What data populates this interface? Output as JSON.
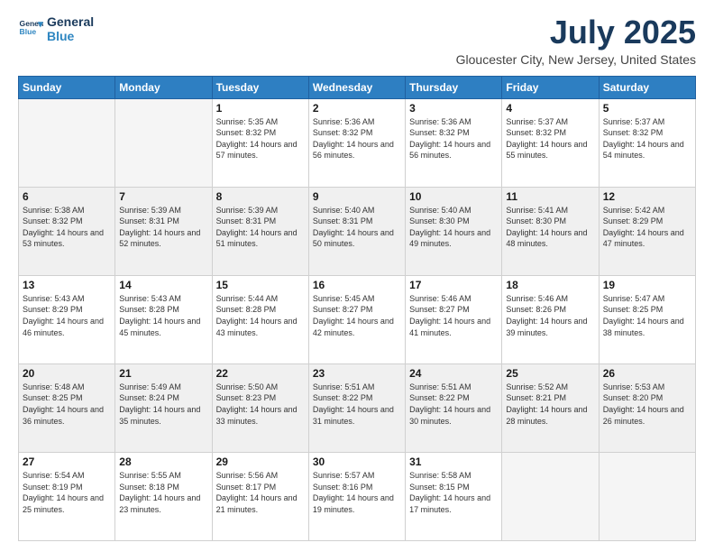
{
  "header": {
    "logo_line1": "General",
    "logo_line2": "Blue",
    "title": "July 2025",
    "subtitle": "Gloucester City, New Jersey, United States"
  },
  "weekdays": [
    "Sunday",
    "Monday",
    "Tuesday",
    "Wednesday",
    "Thursday",
    "Friday",
    "Saturday"
  ],
  "weeks": [
    [
      {
        "day": "",
        "sunrise": "",
        "sunset": "",
        "daylight": "",
        "empty": true
      },
      {
        "day": "",
        "sunrise": "",
        "sunset": "",
        "daylight": "",
        "empty": true
      },
      {
        "day": "1",
        "sunrise": "Sunrise: 5:35 AM",
        "sunset": "Sunset: 8:32 PM",
        "daylight": "Daylight: 14 hours and 57 minutes.",
        "empty": false
      },
      {
        "day": "2",
        "sunrise": "Sunrise: 5:36 AM",
        "sunset": "Sunset: 8:32 PM",
        "daylight": "Daylight: 14 hours and 56 minutes.",
        "empty": false
      },
      {
        "day": "3",
        "sunrise": "Sunrise: 5:36 AM",
        "sunset": "Sunset: 8:32 PM",
        "daylight": "Daylight: 14 hours and 56 minutes.",
        "empty": false
      },
      {
        "day": "4",
        "sunrise": "Sunrise: 5:37 AM",
        "sunset": "Sunset: 8:32 PM",
        "daylight": "Daylight: 14 hours and 55 minutes.",
        "empty": false
      },
      {
        "day": "5",
        "sunrise": "Sunrise: 5:37 AM",
        "sunset": "Sunset: 8:32 PM",
        "daylight": "Daylight: 14 hours and 54 minutes.",
        "empty": false
      }
    ],
    [
      {
        "day": "6",
        "sunrise": "Sunrise: 5:38 AM",
        "sunset": "Sunset: 8:32 PM",
        "daylight": "Daylight: 14 hours and 53 minutes.",
        "empty": false
      },
      {
        "day": "7",
        "sunrise": "Sunrise: 5:39 AM",
        "sunset": "Sunset: 8:31 PM",
        "daylight": "Daylight: 14 hours and 52 minutes.",
        "empty": false
      },
      {
        "day": "8",
        "sunrise": "Sunrise: 5:39 AM",
        "sunset": "Sunset: 8:31 PM",
        "daylight": "Daylight: 14 hours and 51 minutes.",
        "empty": false
      },
      {
        "day": "9",
        "sunrise": "Sunrise: 5:40 AM",
        "sunset": "Sunset: 8:31 PM",
        "daylight": "Daylight: 14 hours and 50 minutes.",
        "empty": false
      },
      {
        "day": "10",
        "sunrise": "Sunrise: 5:40 AM",
        "sunset": "Sunset: 8:30 PM",
        "daylight": "Daylight: 14 hours and 49 minutes.",
        "empty": false
      },
      {
        "day": "11",
        "sunrise": "Sunrise: 5:41 AM",
        "sunset": "Sunset: 8:30 PM",
        "daylight": "Daylight: 14 hours and 48 minutes.",
        "empty": false
      },
      {
        "day": "12",
        "sunrise": "Sunrise: 5:42 AM",
        "sunset": "Sunset: 8:29 PM",
        "daylight": "Daylight: 14 hours and 47 minutes.",
        "empty": false
      }
    ],
    [
      {
        "day": "13",
        "sunrise": "Sunrise: 5:43 AM",
        "sunset": "Sunset: 8:29 PM",
        "daylight": "Daylight: 14 hours and 46 minutes.",
        "empty": false
      },
      {
        "day": "14",
        "sunrise": "Sunrise: 5:43 AM",
        "sunset": "Sunset: 8:28 PM",
        "daylight": "Daylight: 14 hours and 45 minutes.",
        "empty": false
      },
      {
        "day": "15",
        "sunrise": "Sunrise: 5:44 AM",
        "sunset": "Sunset: 8:28 PM",
        "daylight": "Daylight: 14 hours and 43 minutes.",
        "empty": false
      },
      {
        "day": "16",
        "sunrise": "Sunrise: 5:45 AM",
        "sunset": "Sunset: 8:27 PM",
        "daylight": "Daylight: 14 hours and 42 minutes.",
        "empty": false
      },
      {
        "day": "17",
        "sunrise": "Sunrise: 5:46 AM",
        "sunset": "Sunset: 8:27 PM",
        "daylight": "Daylight: 14 hours and 41 minutes.",
        "empty": false
      },
      {
        "day": "18",
        "sunrise": "Sunrise: 5:46 AM",
        "sunset": "Sunset: 8:26 PM",
        "daylight": "Daylight: 14 hours and 39 minutes.",
        "empty": false
      },
      {
        "day": "19",
        "sunrise": "Sunrise: 5:47 AM",
        "sunset": "Sunset: 8:25 PM",
        "daylight": "Daylight: 14 hours and 38 minutes.",
        "empty": false
      }
    ],
    [
      {
        "day": "20",
        "sunrise": "Sunrise: 5:48 AM",
        "sunset": "Sunset: 8:25 PM",
        "daylight": "Daylight: 14 hours and 36 minutes.",
        "empty": false
      },
      {
        "day": "21",
        "sunrise": "Sunrise: 5:49 AM",
        "sunset": "Sunset: 8:24 PM",
        "daylight": "Daylight: 14 hours and 35 minutes.",
        "empty": false
      },
      {
        "day": "22",
        "sunrise": "Sunrise: 5:50 AM",
        "sunset": "Sunset: 8:23 PM",
        "daylight": "Daylight: 14 hours and 33 minutes.",
        "empty": false
      },
      {
        "day": "23",
        "sunrise": "Sunrise: 5:51 AM",
        "sunset": "Sunset: 8:22 PM",
        "daylight": "Daylight: 14 hours and 31 minutes.",
        "empty": false
      },
      {
        "day": "24",
        "sunrise": "Sunrise: 5:51 AM",
        "sunset": "Sunset: 8:22 PM",
        "daylight": "Daylight: 14 hours and 30 minutes.",
        "empty": false
      },
      {
        "day": "25",
        "sunrise": "Sunrise: 5:52 AM",
        "sunset": "Sunset: 8:21 PM",
        "daylight": "Daylight: 14 hours and 28 minutes.",
        "empty": false
      },
      {
        "day": "26",
        "sunrise": "Sunrise: 5:53 AM",
        "sunset": "Sunset: 8:20 PM",
        "daylight": "Daylight: 14 hours and 26 minutes.",
        "empty": false
      }
    ],
    [
      {
        "day": "27",
        "sunrise": "Sunrise: 5:54 AM",
        "sunset": "Sunset: 8:19 PM",
        "daylight": "Daylight: 14 hours and 25 minutes.",
        "empty": false
      },
      {
        "day": "28",
        "sunrise": "Sunrise: 5:55 AM",
        "sunset": "Sunset: 8:18 PM",
        "daylight": "Daylight: 14 hours and 23 minutes.",
        "empty": false
      },
      {
        "day": "29",
        "sunrise": "Sunrise: 5:56 AM",
        "sunset": "Sunset: 8:17 PM",
        "daylight": "Daylight: 14 hours and 21 minutes.",
        "empty": false
      },
      {
        "day": "30",
        "sunrise": "Sunrise: 5:57 AM",
        "sunset": "Sunset: 8:16 PM",
        "daylight": "Daylight: 14 hours and 19 minutes.",
        "empty": false
      },
      {
        "day": "31",
        "sunrise": "Sunrise: 5:58 AM",
        "sunset": "Sunset: 8:15 PM",
        "daylight": "Daylight: 14 hours and 17 minutes.",
        "empty": false
      },
      {
        "day": "",
        "sunrise": "",
        "sunset": "",
        "daylight": "",
        "empty": true
      },
      {
        "day": "",
        "sunrise": "",
        "sunset": "",
        "daylight": "",
        "empty": true
      }
    ]
  ]
}
